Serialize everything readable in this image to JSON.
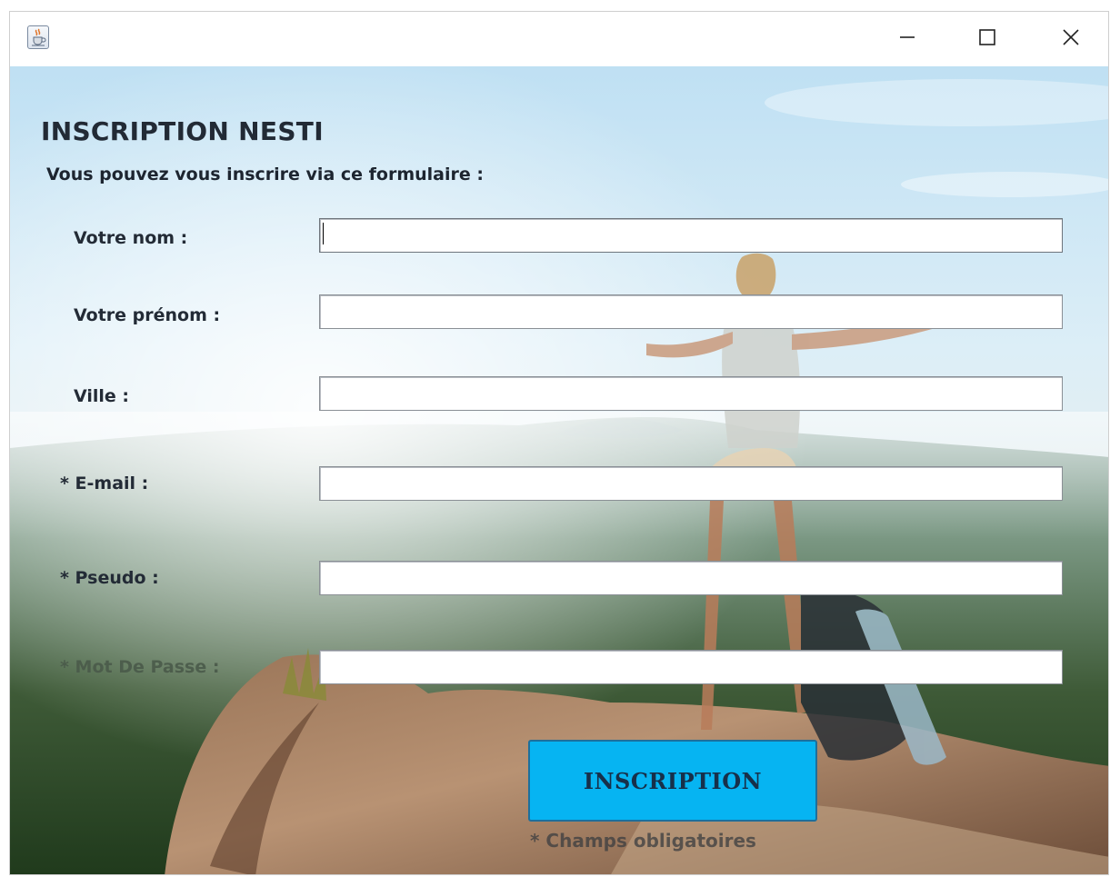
{
  "window": {
    "icon": "java-cup-icon",
    "controls": {
      "minimize_icon": "minimize-icon",
      "maximize_icon": "maximize-icon",
      "close_icon": "close-icon"
    }
  },
  "form": {
    "title": "INSCRIPTION NESTI",
    "subtitle": "Vous pouvez vous inscrire via ce formulaire :",
    "fields": [
      {
        "label": "Votre nom :",
        "value": ""
      },
      {
        "label": "Votre prénom :",
        "value": ""
      },
      {
        "label": "Ville :",
        "value": ""
      },
      {
        "label": "* E-mail :",
        "value": ""
      },
      {
        "label": "* Pseudo :",
        "value": ""
      },
      {
        "label": "* Mot De Passe :",
        "value": ""
      }
    ],
    "submit_label": "INSCRIPTION",
    "footnote": "* Champs obligatoires"
  },
  "colors": {
    "button": "#06b4f2",
    "title_text": "#222a35"
  }
}
